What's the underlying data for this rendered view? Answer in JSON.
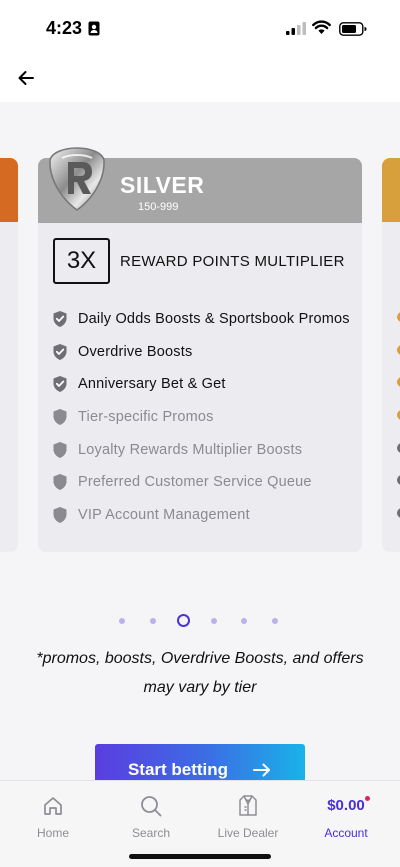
{
  "status_bar": {
    "time": "4:23"
  },
  "tier_card": {
    "name": "SILVER",
    "range": "150-999",
    "multiplier": "3X",
    "multiplier_label": "REWARD POINTS MULTIPLIER",
    "band_color": "#a6a6a6",
    "benefits": [
      {
        "label": "Daily Odds Boosts & Sportsbook Promos",
        "included": true
      },
      {
        "label": "Overdrive Boosts",
        "included": true
      },
      {
        "label": "Anniversary Bet & Get",
        "included": true
      },
      {
        "label": "Tier-specific Promos",
        "included": false
      },
      {
        "label": "Loyalty Rewards Multiplier Boosts",
        "included": false
      },
      {
        "label": "Preferred Customer Service Queue",
        "included": false
      },
      {
        "label": "VIP Account Management",
        "included": false
      }
    ]
  },
  "adjacent_cards": {
    "previous_band_color": "#d56a22",
    "next_band_color": "#d7a03c"
  },
  "pager": {
    "page_count": 6,
    "current_index": 2
  },
  "disclaimer": "*promos, boosts, Overdrive Boosts, and offers may vary by tier",
  "cta": {
    "label": "Start betting",
    "icon": "arrow-right-icon"
  },
  "tab_bar": {
    "tabs": [
      {
        "label": "Home",
        "icon": "home-icon"
      },
      {
        "label": "Search",
        "icon": "search-icon"
      },
      {
        "label": "Live Dealer",
        "icon": "dealer-jacket-icon"
      },
      {
        "label": "Account",
        "balance": "$0.00",
        "active": true
      }
    ]
  },
  "colors": {
    "accent": "#4a2fd6",
    "included_icon": "#6e6e74",
    "excluded_icon": "#8a8a90"
  }
}
